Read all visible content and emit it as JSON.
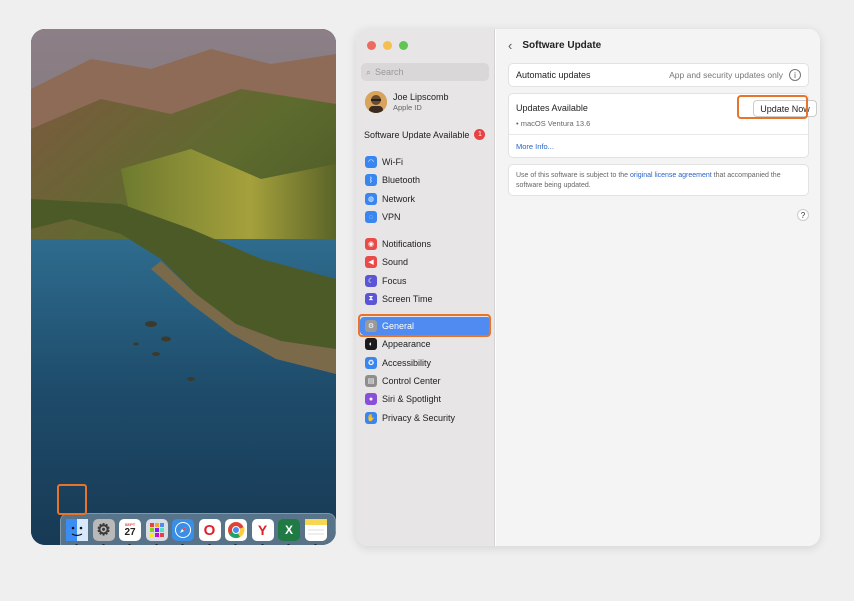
{
  "colors": {
    "accent": "#4f8bf0",
    "highlight": "#e8732a",
    "badge": "#e84141",
    "link": "#2a63c8"
  },
  "dock": {
    "apps": [
      {
        "name": "finder-icon",
        "glyph": "",
        "bg": "#3b8df3"
      },
      {
        "name": "system-settings-icon",
        "glyph": "⚙",
        "bg": "#8a8a8a"
      },
      {
        "name": "calendar-icon",
        "glyph": "27",
        "bg": "#ffffff"
      },
      {
        "name": "launchpad-icon",
        "glyph": "",
        "bg": "#d8dde6"
      },
      {
        "name": "safari-icon",
        "glyph": "",
        "bg": "#3a8ee6"
      },
      {
        "name": "opera-icon",
        "glyph": "O",
        "bg": "#ffffff"
      },
      {
        "name": "chrome-icon",
        "glyph": "",
        "bg": "#ffffff"
      },
      {
        "name": "yandex-browser-icon",
        "glyph": "Y",
        "bg": "#ffffff"
      },
      {
        "name": "excel-icon",
        "glyph": "X",
        "bg": "#1f7a43"
      },
      {
        "name": "notes-icon",
        "glyph": "",
        "bg": "#f6d652"
      }
    ],
    "calendar_month": "SEPT",
    "calendar_day": "27"
  },
  "sidebar": {
    "search_placeholder": "Search",
    "user_name": "Joe Lipscomb",
    "user_sub": "Apple ID",
    "update_label": "Software Update Available",
    "update_badge": "1",
    "groups": [
      [
        {
          "label": "Wi-Fi",
          "icon": "wifi-icon",
          "color": "#3a86f0",
          "glyph": "◠"
        },
        {
          "label": "Bluetooth",
          "icon": "bluetooth-icon",
          "color": "#3a86f0",
          "glyph": "ᛒ"
        },
        {
          "label": "Network",
          "icon": "network-icon",
          "color": "#3a86f0",
          "glyph": "◍"
        },
        {
          "label": "VPN",
          "icon": "vpn-icon",
          "color": "#3a86f0",
          "glyph": "◌"
        }
      ],
      [
        {
          "label": "Notifications",
          "icon": "notifications-icon",
          "color": "#eb4b48",
          "glyph": "◉"
        },
        {
          "label": "Sound",
          "icon": "sound-icon",
          "color": "#eb4b48",
          "glyph": "◀"
        },
        {
          "label": "Focus",
          "icon": "focus-icon",
          "color": "#5b56d6",
          "glyph": "☾"
        },
        {
          "label": "Screen Time",
          "icon": "screen-time-icon",
          "color": "#5b56d6",
          "glyph": "⧗"
        }
      ],
      [
        {
          "label": "General",
          "icon": "gear-icon",
          "color": "#9a9a9a",
          "glyph": "⚙",
          "selected": true
        },
        {
          "label": "Appearance",
          "icon": "appearance-icon",
          "color": "#1b1b1b",
          "glyph": "◐"
        },
        {
          "label": "Accessibility",
          "icon": "accessibility-icon",
          "color": "#3a86f0",
          "glyph": "✪"
        },
        {
          "label": "Control Center",
          "icon": "control-center-icon",
          "color": "#8e8e8e",
          "glyph": "▤"
        },
        {
          "label": "Siri & Spotlight",
          "icon": "siri-icon",
          "color": "#8a4fd8",
          "glyph": "●"
        },
        {
          "label": "Privacy & Security",
          "icon": "privacy-hand-icon",
          "color": "#3a86f0",
          "glyph": "✋"
        }
      ]
    ]
  },
  "main": {
    "title": "Software Update",
    "auto_label": "Automatic updates",
    "auto_value": "App and security updates only",
    "updates_heading": "Updates Available",
    "update_button": "Update Now",
    "version": "• macOS Ventura 13.6",
    "more_info": "More Info...",
    "license_pre": "Use of this software is subject to the ",
    "license_link": "original license agreement",
    "license_post": " that accompanied the software being updated.",
    "help": "?"
  }
}
